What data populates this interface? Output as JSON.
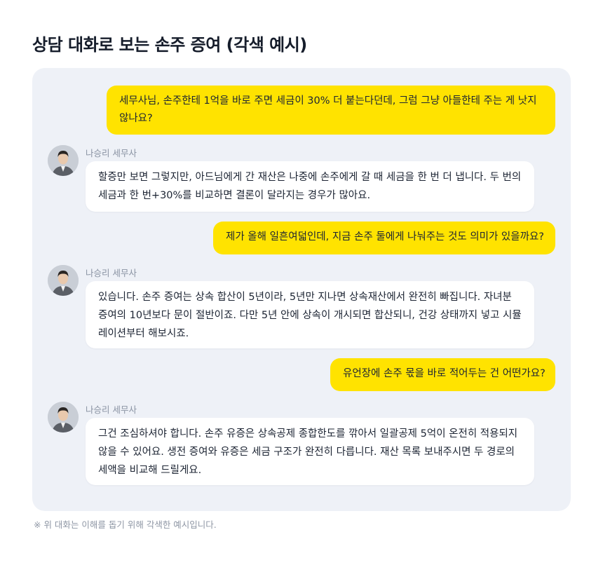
{
  "title": "상담 대화로 보는 손주 증여 (각색 예시)",
  "advisor_name": "나승리 세무사",
  "messages": {
    "m1": "세무사님, 손주한테 1억을 바로 주면 세금이 30% 더 붙는다던데, 그럼 그냥 아들한테 주는 게 낫지 않나요?",
    "m2": "할증만 보면 그렇지만, 아드님에게 간 재산은 나중에 손주에게 갈 때 세금을 한 번 더 냅니다. 두 번의 세금과 한 번+30%를 비교하면 결론이 달라지는 경우가 많아요.",
    "m3": "제가 올해 일흔여덟인데, 지금 손주 둘에게 나눠주는 것도 의미가 있을까요?",
    "m4": "있습니다. 손주 증여는 상속 합산이 5년이라, 5년만 지나면 상속재산에서 완전히 빠집니다. 자녀분 증여의 10년보다 문이 절반이죠. 다만 5년 안에 상속이 개시되면 합산되니, 건강 상태까지 넣고 시뮬레이션부터 해보시죠.",
    "m5": "유언장에 손주 몫을 바로 적어두는 건 어떤가요?",
    "m6": "그건 조심하셔야 합니다. 손주 유증은 상속공제 종합한도를 깎아서 일괄공제 5억이 온전히 적용되지 않을 수 있어요. 생전 증여와 유증은 세금 구조가 완전히 다릅니다. 재산 목록 보내주시면 두 경로의 세액을 비교해 드릴게요."
  },
  "footnote": "※ 위 대화는 이해를 돕기 위해 각색한 예시입니다.",
  "colors": {
    "user_bubble": "#ffe300",
    "bot_bubble": "#ffffff",
    "panel": "#eef1f7"
  },
  "icons": {
    "advisor_avatar": "avatar-icon"
  }
}
